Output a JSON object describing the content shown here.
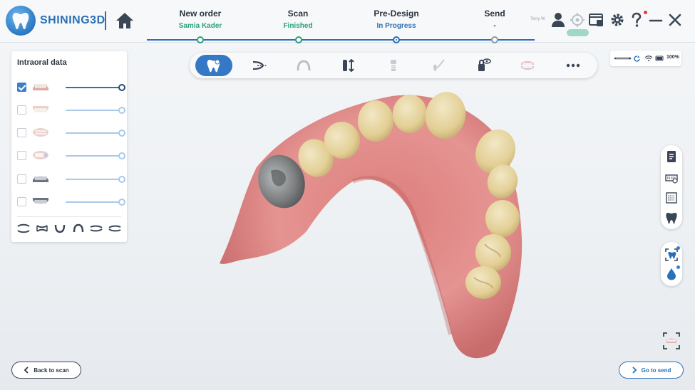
{
  "app": {
    "brand": "SHINING3D",
    "brand_color": "#2a6fb8",
    "accent_color": "#3478c6",
    "done_color": "#2aa07a"
  },
  "steps": [
    {
      "title": "New order",
      "status": "Samia Kader",
      "state": "done",
      "status_color": "#2aa07a"
    },
    {
      "title": "Scan",
      "status": "Finished",
      "state": "done",
      "status_color": "#2aa07a"
    },
    {
      "title": "Pre-Design",
      "status": "In Progress",
      "state": "active",
      "status_color": "#2a6fb8"
    },
    {
      "title": "Send",
      "status": "-",
      "state": "pending",
      "status_color": "#2b3440"
    }
  ],
  "header_right": {
    "user_name": "Terry W",
    "icons": [
      "user-icon",
      "target-icon",
      "screen-icon",
      "gear-icon",
      "help-icon",
      "minimize-icon",
      "close-icon"
    ]
  },
  "left_panel": {
    "title": "Intraoral data",
    "layers": [
      {
        "name": "upper-jaw",
        "checked": true,
        "opacity": 1.0
      },
      {
        "name": "lower-jaw",
        "checked": false,
        "opacity": 1.0
      },
      {
        "name": "upper-bite",
        "checked": false,
        "opacity": 1.0
      },
      {
        "name": "lower-bite",
        "checked": false,
        "opacity": 1.0
      },
      {
        "name": "upper-pre-op",
        "checked": false,
        "opacity": 1.0
      },
      {
        "name": "lower-pre-op",
        "checked": false,
        "opacity": 1.0
      }
    ],
    "view_icons": [
      "arch-front-icon",
      "arch-both-icon",
      "arch-lower-icon",
      "arch-upper-icon",
      "arch-left-icon",
      "arch-right-icon"
    ]
  },
  "toolbar": {
    "tools": [
      {
        "name": "tooth-edit-tool",
        "active": true
      },
      {
        "name": "margin-line-tool",
        "active": false
      },
      {
        "name": "arch-tool",
        "active": false
      },
      {
        "name": "insertion-axis-tool",
        "active": false
      },
      {
        "name": "abutment-tool",
        "active": false
      },
      {
        "name": "sculpt-tool",
        "active": false
      },
      {
        "name": "visibility-lock-tool",
        "active": false
      },
      {
        "name": "occlusion-tool",
        "active": false
      },
      {
        "name": "more-tool",
        "active": false
      }
    ]
  },
  "status": {
    "battery": "100%"
  },
  "side_tools": [
    "report-icon",
    "occlusion-map-icon",
    "measure-icon",
    "tooth-icon",
    "tooth-select-icon",
    "water-drop-icon"
  ],
  "buttons": {
    "back": "Back to scan",
    "next": "Go to send"
  }
}
